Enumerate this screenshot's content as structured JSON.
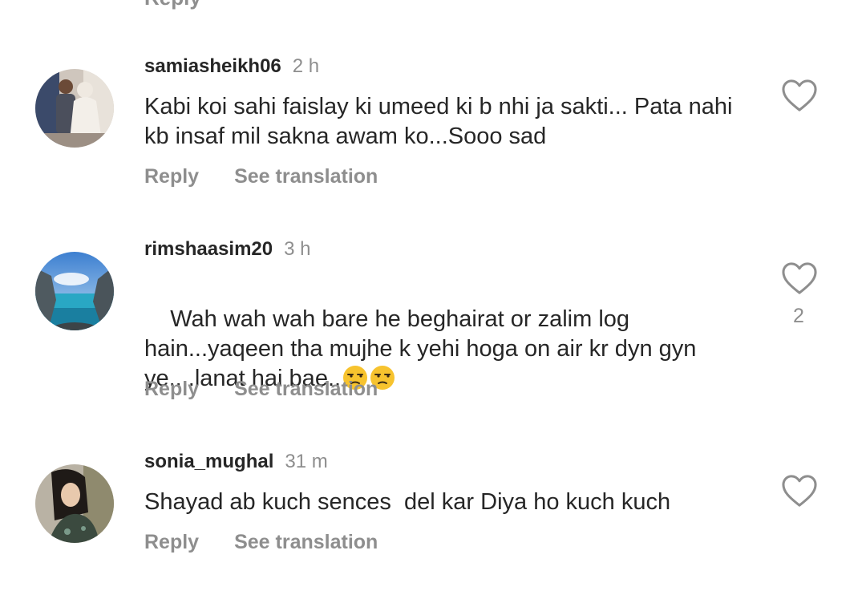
{
  "top_partial": {
    "reply_label": "Reply"
  },
  "comments": [
    {
      "username": "samiasheikh06",
      "time": "2 h",
      "text": "Kabi koi sahi faislay ki umeed ki b nhi ja sakti... Pata nahi kb insaf mil sakna awam ko...Sooo sad",
      "reply_label": "Reply",
      "translation_label": "See translation",
      "likes": ""
    },
    {
      "username": "rimshaasim20",
      "time": "3 h",
      "text": "Wah wah wah bare he beghairat or zalim log hain...yaqeen tha mujhe k yehi hoga on air kr dyn gyn ye....lanat hai bae..",
      "emojis": [
        "unamused-face",
        "unamused-face"
      ],
      "reply_label": "Reply",
      "translation_label": "See translation",
      "likes": "2"
    },
    {
      "username": "sonia_mughal",
      "time": "31 m",
      "text": "Shayad ab kuch sences  del kar Diya ho kuch kuch",
      "reply_label": "Reply",
      "translation_label": "See translation",
      "likes": ""
    }
  ],
  "icons": {
    "like": "heart-outline-icon",
    "emoji": "unamused-face-emoji"
  },
  "colors": {
    "text": "#262626",
    "secondary": "#8e8e8e",
    "emoji": "#f7c32e"
  }
}
